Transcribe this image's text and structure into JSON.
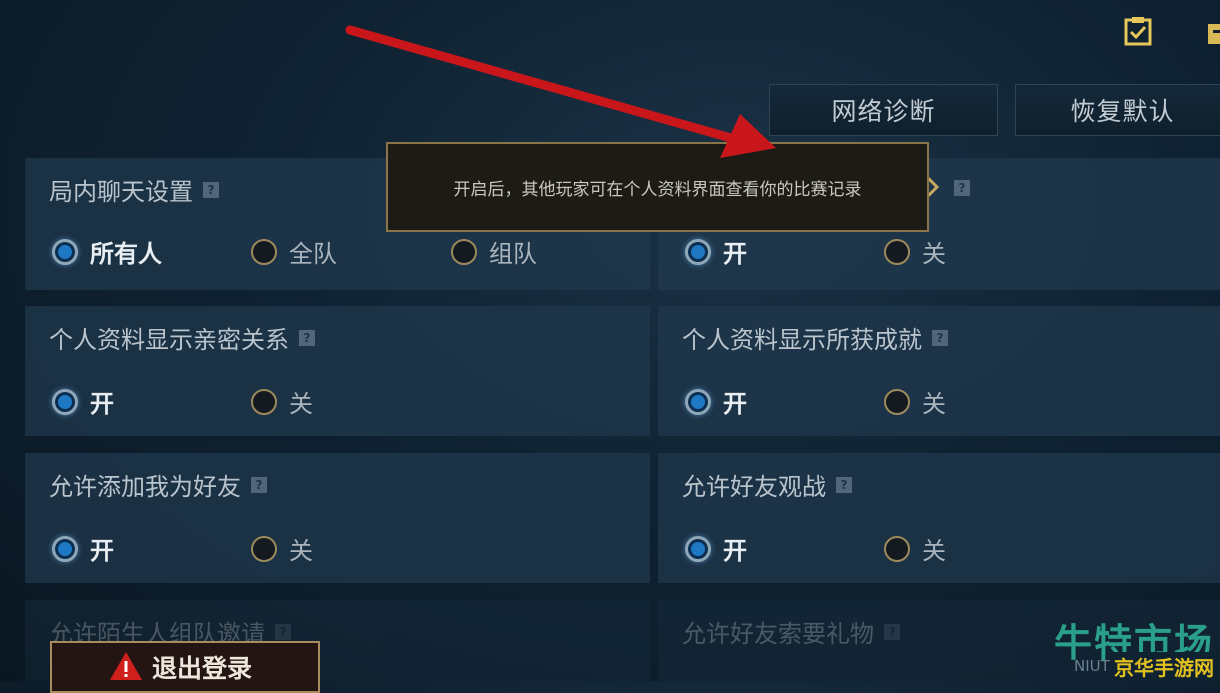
{
  "header": {
    "diagnose_label": "网络诊断",
    "restore_label": "恢复默认"
  },
  "tooltip": {
    "text": "开启后，其他玩家可在个人资料界面查看你的比赛记录"
  },
  "settings": {
    "in_game_chat": {
      "title": "局内聊天设置",
      "options": [
        "所有人",
        "全队",
        "组队"
      ],
      "selected": "所有人"
    },
    "match_history": {
      "options": [
        "开",
        "关"
      ],
      "selected": "开"
    },
    "show_intimacy": {
      "title": "个人资料显示亲密关系",
      "options": [
        "开",
        "关"
      ],
      "selected": "开"
    },
    "show_achievements": {
      "title": "个人资料显示所获成就",
      "options": [
        "开",
        "关"
      ],
      "selected": "开"
    },
    "allow_add_friend": {
      "title": "允许添加我为好友",
      "options": [
        "开",
        "关"
      ],
      "selected": "开"
    },
    "allow_friend_spectate": {
      "title": "允许好友观战",
      "options": [
        "开",
        "关"
      ],
      "selected": "开"
    },
    "stranger_invite": {
      "title": "允许陌生人组队邀请"
    },
    "friend_gift_request": {
      "title": "允许好友索要礼物"
    }
  },
  "logout_label": "退出登录",
  "help_glyph": "?",
  "watermark": {
    "brand": "牛特市场",
    "sub": "京华手游网",
    "latin": "NIUT"
  },
  "colors": {
    "selected_radio": "#1e78c4",
    "accent_gold": "#a78c5c",
    "annotation_arrow": "#c8161b"
  }
}
